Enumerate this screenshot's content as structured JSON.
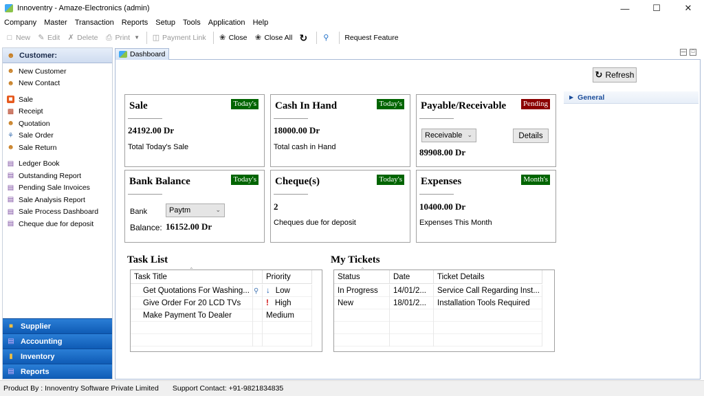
{
  "window": {
    "title": "Innoventry - Amaze-Electronics (admin)"
  },
  "menu": [
    "Company",
    "Master",
    "Transaction",
    "Reports",
    "Setup",
    "Tools",
    "Application",
    "Help"
  ],
  "toolbar": {
    "new": "New",
    "edit": "Edit",
    "delete": "Delete",
    "print": "Print",
    "payment_link": "Payment Link",
    "close": "Close",
    "close_all": "Close All",
    "request_feature": "Request Feature"
  },
  "sidebar": {
    "header": "Customer:",
    "group1": [
      "New Customer",
      "New Contact"
    ],
    "group2": [
      "Sale",
      "Receipt",
      "Quotation",
      "Sale Order",
      "Sale Return"
    ],
    "group3": [
      "Ledger Book",
      "Outstanding Report",
      "Pending Sale Invoices",
      "Sale Analysis Report",
      "Sale Process Dashboard",
      "Cheque due for deposit"
    ],
    "nav": [
      "Supplier",
      "Accounting",
      "Inventory",
      "Reports"
    ]
  },
  "tab": {
    "label": "Dashboard"
  },
  "refresh_label": "Refresh",
  "general_label": "General",
  "cards": {
    "sale": {
      "title": "Sale",
      "badge": "Today's",
      "value": "24192.00 Dr",
      "sub": "Total Today's Sale"
    },
    "cash": {
      "title": "Cash In Hand",
      "badge": "Today's",
      "value": "18000.00 Dr",
      "sub": "Total cash in Hand"
    },
    "payable": {
      "title": "Payable/Receivable",
      "badge": "Pending",
      "combo": "Receivable",
      "details": "Details",
      "value": "89908.00 Dr"
    },
    "bank": {
      "title": "Bank Balance",
      "badge": "Today's",
      "bank_label": "Bank",
      "bank_value": "Paytm",
      "balance_label": "Balance:",
      "value": "16152.00 Dr"
    },
    "cheque": {
      "title": "Cheque(s)",
      "badge": "Today's",
      "value": "2",
      "sub": "Cheques due for deposit"
    },
    "expenses": {
      "title": "Expenses",
      "badge": "Month's",
      "value": "10400.00 Dr",
      "sub": "Expenses This Month"
    }
  },
  "colors": {
    "badge_green": "#006400",
    "badge_red": "#8b0000",
    "nav_blue": "#1565c0"
  },
  "task_list": {
    "title": "Task List",
    "headers": [
      "Task Title",
      "Priority"
    ],
    "rows": [
      {
        "title": "Get Quotations For Washing...",
        "priority": "Low",
        "priority_icon": "down-arrow-icon"
      },
      {
        "title": "Give Order For 20 LCD TVs",
        "priority": "High",
        "priority_icon": "exclamation-icon"
      },
      {
        "title": "Make Payment To Dealer",
        "priority": "Medium",
        "priority_icon": ""
      }
    ]
  },
  "tickets": {
    "title": "My Tickets",
    "headers": [
      "Status",
      "Date",
      "Ticket Details"
    ],
    "rows": [
      {
        "status": "In Progress",
        "date": "14/01/2...",
        "details": "Service Call Regarding Inst..."
      },
      {
        "status": "New",
        "date": "18/01/2...",
        "details": "Installation Tools Required"
      }
    ]
  },
  "status": {
    "product_by": "Product By : Innoventry Software Private Limited",
    "support": "Support Contact: +91-9821834835"
  }
}
